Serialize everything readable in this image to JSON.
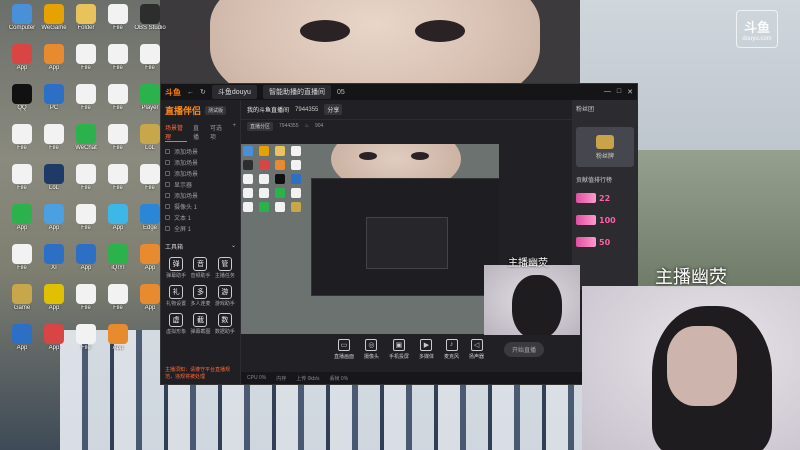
{
  "desktop_icons": [
    {
      "label": "Computer",
      "color": "#4a90d9"
    },
    {
      "label": "WeGame",
      "color": "#e7a100"
    },
    {
      "label": "Folder",
      "color": "#e8c25a"
    },
    {
      "label": "File",
      "color": "#f2f2f2"
    },
    {
      "label": "OBS Studio",
      "color": "#2d2d2d"
    },
    {
      "label": "App",
      "color": "#d94545"
    },
    {
      "label": "App",
      "color": "#e88b2e"
    },
    {
      "label": "File",
      "color": "#f2f2f2"
    },
    {
      "label": "File",
      "color": "#f2f2f2"
    },
    {
      "label": "File",
      "color": "#f2f2f2"
    },
    {
      "label": "QQ",
      "color": "#111111"
    },
    {
      "label": "PC",
      "color": "#2d6fc4"
    },
    {
      "label": "File",
      "color": "#f2f2f2"
    },
    {
      "label": "File",
      "color": "#f2f2f2"
    },
    {
      "label": "Player",
      "color": "#2bb24c"
    },
    {
      "label": "File",
      "color": "#f2f2f2"
    },
    {
      "label": "File",
      "color": "#f2f2f2"
    },
    {
      "label": "WeChat",
      "color": "#2bb24c"
    },
    {
      "label": "File",
      "color": "#f2f2f2"
    },
    {
      "label": "LoL",
      "color": "#c8a64a"
    },
    {
      "label": "File",
      "color": "#f2f2f2"
    },
    {
      "label": "LoL",
      "color": "#1f3a66"
    },
    {
      "label": "File",
      "color": "#f2f2f2"
    },
    {
      "label": "File",
      "color": "#f2f2f2"
    },
    {
      "label": "File",
      "color": "#f2f2f2"
    },
    {
      "label": "App",
      "color": "#2bb24c"
    },
    {
      "label": "App",
      "color": "#4aa0e0"
    },
    {
      "label": "File",
      "color": "#f2f2f2"
    },
    {
      "label": "App",
      "color": "#3db6e8"
    },
    {
      "label": "Edge",
      "color": "#2a86d6"
    },
    {
      "label": "File",
      "color": "#f2f2f2"
    },
    {
      "label": "XI",
      "color": "#2d6fc4"
    },
    {
      "label": "App",
      "color": "#2d6fc4"
    },
    {
      "label": "iQIYI",
      "color": "#2bb24c"
    },
    {
      "label": "App",
      "color": "#e88b2e"
    },
    {
      "label": "Game",
      "color": "#c8a64a"
    },
    {
      "label": "App",
      "color": "#e0c000"
    },
    {
      "label": "File",
      "color": "#f2f2f2"
    },
    {
      "label": "File",
      "color": "#f2f2f2"
    },
    {
      "label": "App",
      "color": "#e88b2e"
    },
    {
      "label": "App",
      "color": "#2d6fc4"
    },
    {
      "label": "App",
      "color": "#d94545"
    },
    {
      "label": "File",
      "color": "#f2f2f2"
    },
    {
      "label": "App",
      "color": "#e88b2e"
    }
  ],
  "corner_logo": {
    "big": "斗鱼",
    "small": "douyu.com"
  },
  "app": {
    "titlebar": {
      "logo": "斗鱼",
      "tab1": "斗鱼douyu",
      "tab2": "智能助播的直播间",
      "tab3": "05"
    },
    "brand": {
      "name": "直播伴侣",
      "version": "测试版"
    },
    "sidebar_tabs": [
      "场景管理",
      "直播",
      "可选项"
    ],
    "scene_items": [
      "添加场景",
      "添加场景",
      "添加场景",
      "显示器",
      "添加场景",
      "摄像头 1",
      "文本 1",
      "全屏 1"
    ],
    "tools_title": "工具箱",
    "tools": [
      {
        "icon": "弹",
        "label": "弹幕助手"
      },
      {
        "icon": "音",
        "label": "音频助手"
      },
      {
        "icon": "管",
        "label": "主播任务"
      },
      {
        "icon": "礼",
        "label": "礼物设置"
      },
      {
        "icon": "多",
        "label": "多人连麦"
      },
      {
        "icon": "游",
        "label": "游戏助手"
      },
      {
        "icon": "虚",
        "label": "虚拟形象"
      },
      {
        "icon": "截",
        "label": "弹幕截图"
      },
      {
        "icon": "数",
        "label": "数据助手"
      }
    ],
    "notice": "主播须知：请遵守平台直播规范，违规将被处理",
    "room": {
      "title": "我的斗鱼直播间",
      "room_id": "7944355",
      "share_btn": "分享",
      "sub_label": "直播分区",
      "sub_id": "7944355",
      "viewers": "904"
    },
    "bottom_bar": [
      {
        "icon": "▭",
        "label": "直播画面"
      },
      {
        "icon": "◎",
        "label": "摄像头"
      },
      {
        "icon": "▣",
        "label": "手机投屏"
      },
      {
        "icon": "▶",
        "label": "多媒体"
      },
      {
        "icon": "♪",
        "label": "麦克风"
      },
      {
        "icon": "◁",
        "label": "扬声器"
      }
    ],
    "start_label": "开始直播",
    "status": [
      "CPU 0%",
      "内存",
      "上传 0kb/s",
      "丢帧 0%"
    ]
  },
  "right_panel": {
    "header": "粉丝团",
    "gift_caption": "粉丝牌",
    "rank_title": "贡献值排行榜",
    "ranks": [
      "22",
      "100",
      "50"
    ]
  },
  "anchor_label": "主播幽荧",
  "anchor_label_small": "主播幽荧"
}
